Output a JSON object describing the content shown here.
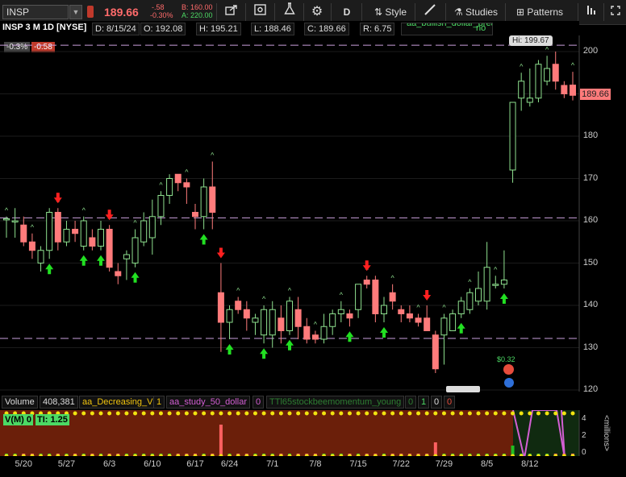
{
  "toolbar": {
    "symbol": "INSP",
    "last_price": "189.66",
    "net_change": "-.58",
    "pct_change": "-0.30%",
    "bid": "B: 160.00",
    "ask": "A: 220.00",
    "timeframe": "D",
    "style_label": "Style",
    "studies_label": "Studies",
    "patterns_label": "Patterns"
  },
  "header": {
    "title": "INSP 3 M 1D [NYSE]",
    "date": "D: 8/15/24",
    "open": "O: 192.08",
    "high": "H: 195.21",
    "low": "L: 188.46",
    "close": "C: 189.66",
    "range": "R: 6.75",
    "study_banner": "aa_bullish_dollar_breakout",
    "study_banner_value": "no",
    "pct_badge": "-0.3%",
    "chg_badge": "-0.58"
  },
  "chart_labels": {
    "hi_bubble": "Hi: 199.67",
    "current_price": "189.66",
    "dividend_note": "$0.32"
  },
  "lower_panel": {
    "volume_label": "Volume",
    "volume_value": "408,381",
    "study1": "aa_Decreasing_V",
    "study1_val": "1",
    "study2": "aa_study_50_dollar",
    "study2_val": "0",
    "study3": "TTl65stockbeemomentum_young",
    "study3_vals": [
      "0",
      "1",
      "0",
      "0"
    ],
    "vm_badge": "V(M) 0",
    "ti_badge": "TI: 1.25",
    "axis_label": "<millions>",
    "axis_ticks": [
      "4",
      "2",
      "0"
    ]
  },
  "chart_data": {
    "type": "candlestick",
    "symbol": "INSP",
    "interval": "1D",
    "y_ticks": [
      200,
      190,
      180,
      170,
      160,
      150,
      140,
      130,
      120
    ],
    "x_ticks": [
      "5/20",
      "5/27",
      "6/3",
      "6/10",
      "6/17",
      "6/24",
      "7/1",
      "7/8",
      "7/15",
      "7/22",
      "7/29",
      "8/5",
      "8/12"
    ],
    "ylim": [
      119.5,
      202.5
    ],
    "hlines": [
      201.5,
      160.7,
      132.2
    ],
    "candles": [
      {
        "o": 160.5,
        "h": 161,
        "l": 156,
        "c": 160.5
      },
      {
        "o": 160,
        "h": 163,
        "l": 156,
        "c": 160
      },
      {
        "o": 159,
        "h": 161,
        "l": 154,
        "c": 155
      },
      {
        "o": 155,
        "h": 157,
        "l": 151,
        "c": 153
      },
      {
        "o": 150,
        "h": 154,
        "l": 148,
        "c": 153
      },
      {
        "o": 153,
        "h": 163,
        "l": 151,
        "c": 162
      },
      {
        "o": 162,
        "h": 163,
        "l": 153,
        "c": 155
      },
      {
        "o": 155,
        "h": 160,
        "l": 154,
        "c": 158
      },
      {
        "o": 158,
        "h": 160,
        "l": 155,
        "c": 157
      },
      {
        "o": 154,
        "h": 161,
        "l": 153,
        "c": 160
      },
      {
        "o": 156,
        "h": 158,
        "l": 153,
        "c": 154
      },
      {
        "o": 154,
        "h": 160,
        "l": 153,
        "c": 158
      },
      {
        "o": 158,
        "h": 159,
        "l": 148,
        "c": 149
      },
      {
        "o": 148,
        "h": 150,
        "l": 145,
        "c": 147
      },
      {
        "o": 151,
        "h": 153,
        "l": 146,
        "c": 152
      },
      {
        "o": 150,
        "h": 158,
        "l": 149,
        "c": 156
      },
      {
        "o": 155,
        "h": 162,
        "l": 154,
        "c": 160
      },
      {
        "o": 156,
        "h": 165,
        "l": 152,
        "c": 161
      },
      {
        "o": 161,
        "h": 167,
        "l": 159,
        "c": 166
      },
      {
        "o": 166,
        "h": 171,
        "l": 164,
        "c": 170
      },
      {
        "o": 171,
        "h": 171,
        "l": 167,
        "c": 169
      },
      {
        "o": 169,
        "h": 170,
        "l": 164,
        "c": 168
      },
      {
        "o": 162,
        "h": 164,
        "l": 158,
        "c": 161
      },
      {
        "o": 161,
        "h": 170,
        "l": 158,
        "c": 168
      },
      {
        "o": 168,
        "h": 174,
        "l": 158,
        "c": 162
      },
      {
        "o": 143,
        "h": 150,
        "l": 129,
        "c": 136
      },
      {
        "o": 136,
        "h": 140,
        "l": 132,
        "c": 139
      },
      {
        "o": 141,
        "h": 142,
        "l": 138,
        "c": 139
      },
      {
        "o": 139,
        "h": 141,
        "l": 134,
        "c": 137
      },
      {
        "o": 136,
        "h": 138,
        "l": 133,
        "c": 137
      },
      {
        "o": 133,
        "h": 140,
        "l": 131,
        "c": 139
      },
      {
        "o": 133,
        "h": 141,
        "l": 130,
        "c": 139
      },
      {
        "o": 137,
        "h": 140,
        "l": 131,
        "c": 134
      },
      {
        "o": 134,
        "h": 142,
        "l": 133,
        "c": 141
      },
      {
        "o": 139,
        "h": 142,
        "l": 132,
        "c": 135
      },
      {
        "o": 135,
        "h": 137,
        "l": 131,
        "c": 132
      },
      {
        "o": 133,
        "h": 134,
        "l": 131,
        "c": 132
      },
      {
        "o": 132,
        "h": 138,
        "l": 131,
        "c": 135
      },
      {
        "o": 135,
        "h": 139,
        "l": 133,
        "c": 138
      },
      {
        "o": 138,
        "h": 141,
        "l": 136,
        "c": 139
      },
      {
        "o": 138,
        "h": 139,
        "l": 135,
        "c": 137
      },
      {
        "o": 139,
        "h": 145,
        "l": 137,
        "c": 145
      },
      {
        "o": 146,
        "h": 147,
        "l": 144,
        "c": 145
      },
      {
        "o": 146,
        "h": 147,
        "l": 136,
        "c": 138
      },
      {
        "o": 138,
        "h": 142,
        "l": 136,
        "c": 140
      },
      {
        "o": 143,
        "h": 145,
        "l": 139,
        "c": 141
      },
      {
        "o": 139,
        "h": 140,
        "l": 136,
        "c": 138
      },
      {
        "o": 138,
        "h": 140,
        "l": 136,
        "c": 137
      },
      {
        "o": 137,
        "h": 138,
        "l": 135,
        "c": 136
      },
      {
        "o": 137,
        "h": 140,
        "l": 135,
        "c": 134
      },
      {
        "o": 133,
        "h": 134,
        "l": 124,
        "c": 125
      },
      {
        "o": 133,
        "h": 138,
        "l": 126,
        "c": 137
      },
      {
        "o": 134,
        "h": 139,
        "l": 134,
        "c": 138
      },
      {
        "o": 138,
        "h": 142,
        "l": 137,
        "c": 141
      },
      {
        "o": 139,
        "h": 144,
        "l": 138,
        "c": 143
      },
      {
        "o": 141,
        "h": 148,
        "l": 140,
        "c": 144
      },
      {
        "o": 141,
        "h": 155,
        "l": 139,
        "c": 149
      },
      {
        "o": 145,
        "h": 147,
        "l": 144,
        "c": 145
      },
      {
        "o": 145,
        "h": 153,
        "l": 144,
        "c": 146
      },
      {
        "o": 172,
        "h": 187,
        "l": 169,
        "c": 188
      },
      {
        "o": 189,
        "h": 195,
        "l": 186,
        "c": 193
      },
      {
        "o": 188,
        "h": 196,
        "l": 187,
        "c": 189
      },
      {
        "o": 189,
        "h": 198,
        "l": 188,
        "c": 197
      },
      {
        "o": 193,
        "h": 199,
        "l": 192,
        "c": 196
      },
      {
        "o": 197,
        "h": 200,
        "l": 191,
        "c": 193
      },
      {
        "o": 192,
        "h": 193,
        "l": 189,
        "c": 190
      },
      {
        "o": 192.08,
        "h": 195.21,
        "l": 188.46,
        "c": 189.66
      }
    ],
    "buy_arrows": [
      5,
      9,
      11,
      15,
      23,
      26,
      30,
      33,
      40,
      44,
      53,
      58
    ],
    "sell_arrows": [
      6,
      12,
      25,
      42,
      49
    ]
  }
}
